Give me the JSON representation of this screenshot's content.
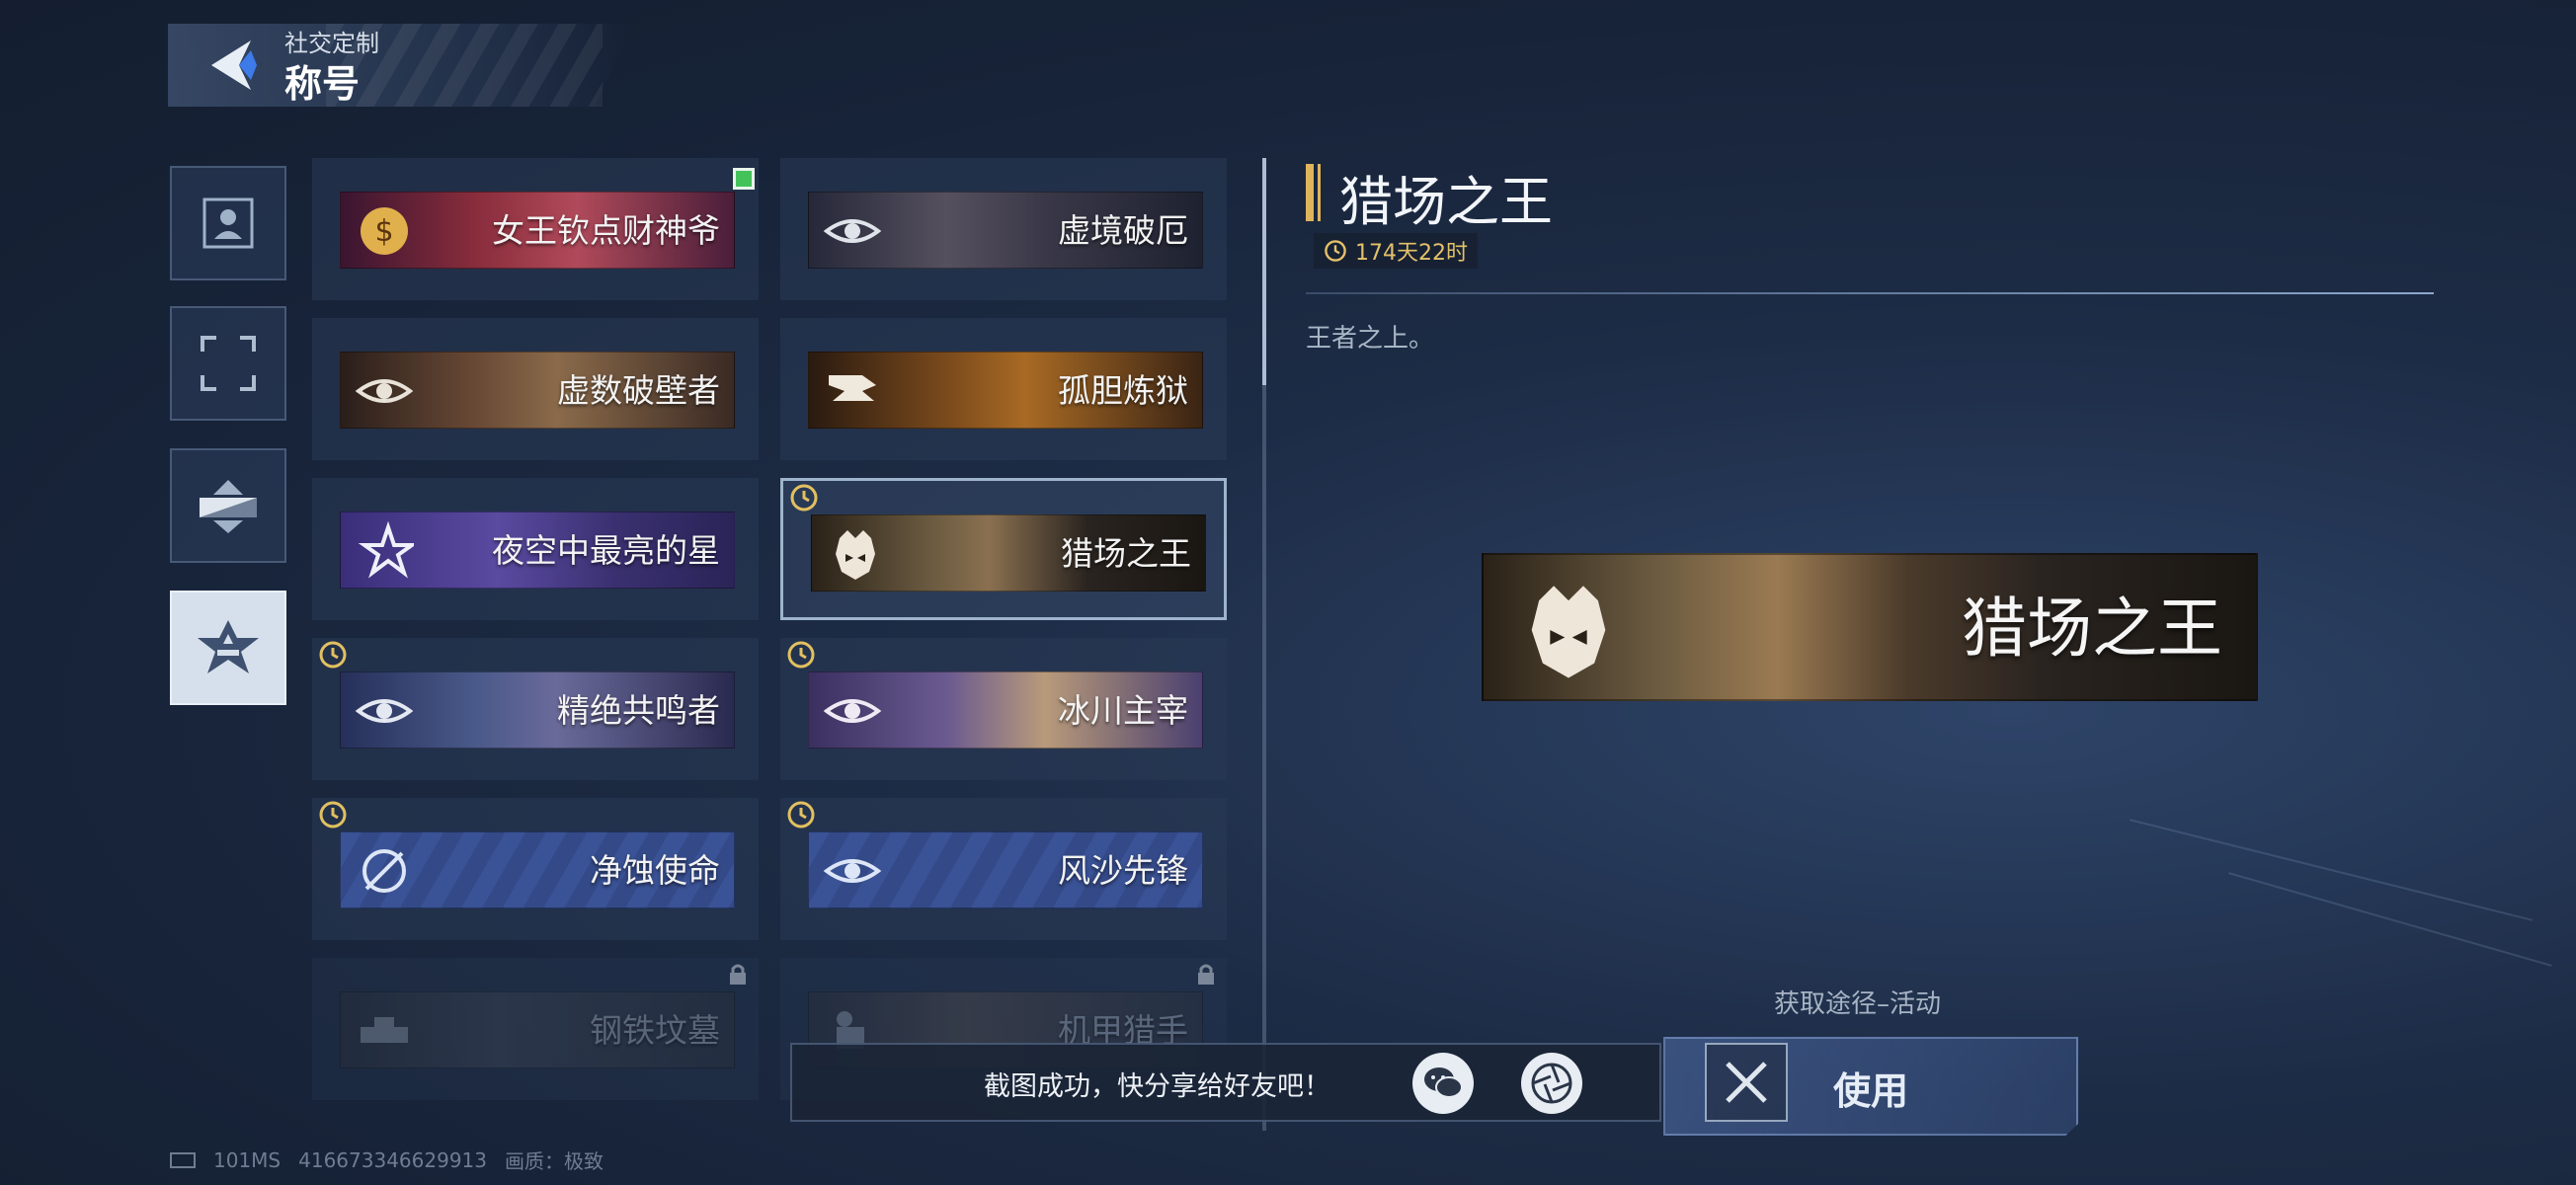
{
  "header": {
    "section": "社交定制",
    "title": "称号"
  },
  "titles": [
    {
      "label": "女王钦点财神爷",
      "theme": "#7a2a3a",
      "badge": "new"
    },
    {
      "label": "虚境破厄",
      "theme": "#3c3a48"
    },
    {
      "label": "虚数破壁者",
      "theme": "#5a4030"
    },
    {
      "label": "孤胆炼狱",
      "theme": "#5a3a1a"
    },
    {
      "label": "夜空中最亮的星",
      "theme": "#3a3270"
    },
    {
      "label": "猎场之王",
      "theme": "#3a3024",
      "badge": "clock",
      "selected": true
    },
    {
      "label": "精绝共鸣者",
      "theme": "#2e3a66",
      "badge": "clock"
    },
    {
      "label": "冰川主宰",
      "theme": "#5a4a72",
      "badge": "clock"
    },
    {
      "label": "净蚀使命",
      "theme": "#37508a",
      "badge": "clock"
    },
    {
      "label": "风沙先锋",
      "theme": "#37508a",
      "badge": "clock"
    },
    {
      "label": "钢铁坟墓",
      "theme": "#2c3546",
      "badge": "lock"
    },
    {
      "label": "机甲猎手",
      "theme": "#2c3546",
      "badge": "lock"
    }
  ],
  "detail": {
    "title": "猎场之王",
    "remaining": "174天22时",
    "description": "王者之上。",
    "banner_label": "猎场之王",
    "source": "获取途径–活动",
    "use_label": "使用"
  },
  "toast": {
    "message": "截图成功，快分享给好友吧！"
  },
  "footer": {
    "latency": "101MS",
    "uid": "416673346629913",
    "quality_label": "画质：",
    "quality_value": "极致"
  }
}
